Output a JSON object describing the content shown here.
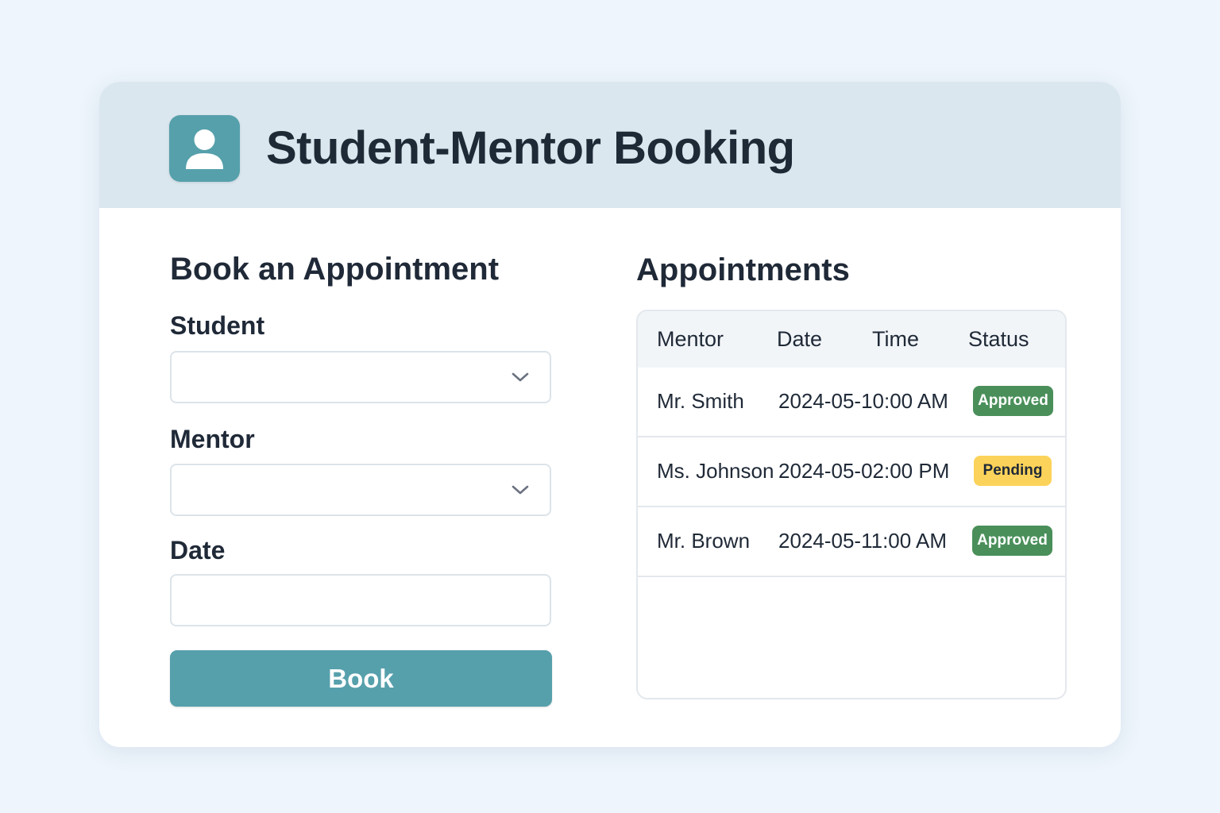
{
  "header": {
    "app_icon": "user-avatar-icon",
    "title": "Student-Mentor Booking"
  },
  "form": {
    "title": "Book an Appointment",
    "student_label": "Student",
    "student_value": "",
    "mentor_label": "Mentor",
    "mentor_value": "",
    "date_label": "Date",
    "date_value": "",
    "book_button": "Book"
  },
  "appointments": {
    "title": "Appointments",
    "columns": [
      "Mentor",
      "Date",
      "Time",
      "Status"
    ],
    "rows": [
      {
        "mentor": "Mr. Smith",
        "datetime": "2024-05-10:00 AM",
        "status": "Approved"
      },
      {
        "mentor": "Ms. Johnson",
        "datetime": "2024-05-02:00 PM",
        "status": "Pending"
      },
      {
        "mentor": "Mr. Brown",
        "datetime": "2024-05-11:00 AM",
        "status": "Approved"
      }
    ]
  },
  "colors": {
    "accent": "#56a0ac",
    "header_bg": "#dbe7ef",
    "approved": "#4a8f5a",
    "pending": "#fcd35a"
  }
}
